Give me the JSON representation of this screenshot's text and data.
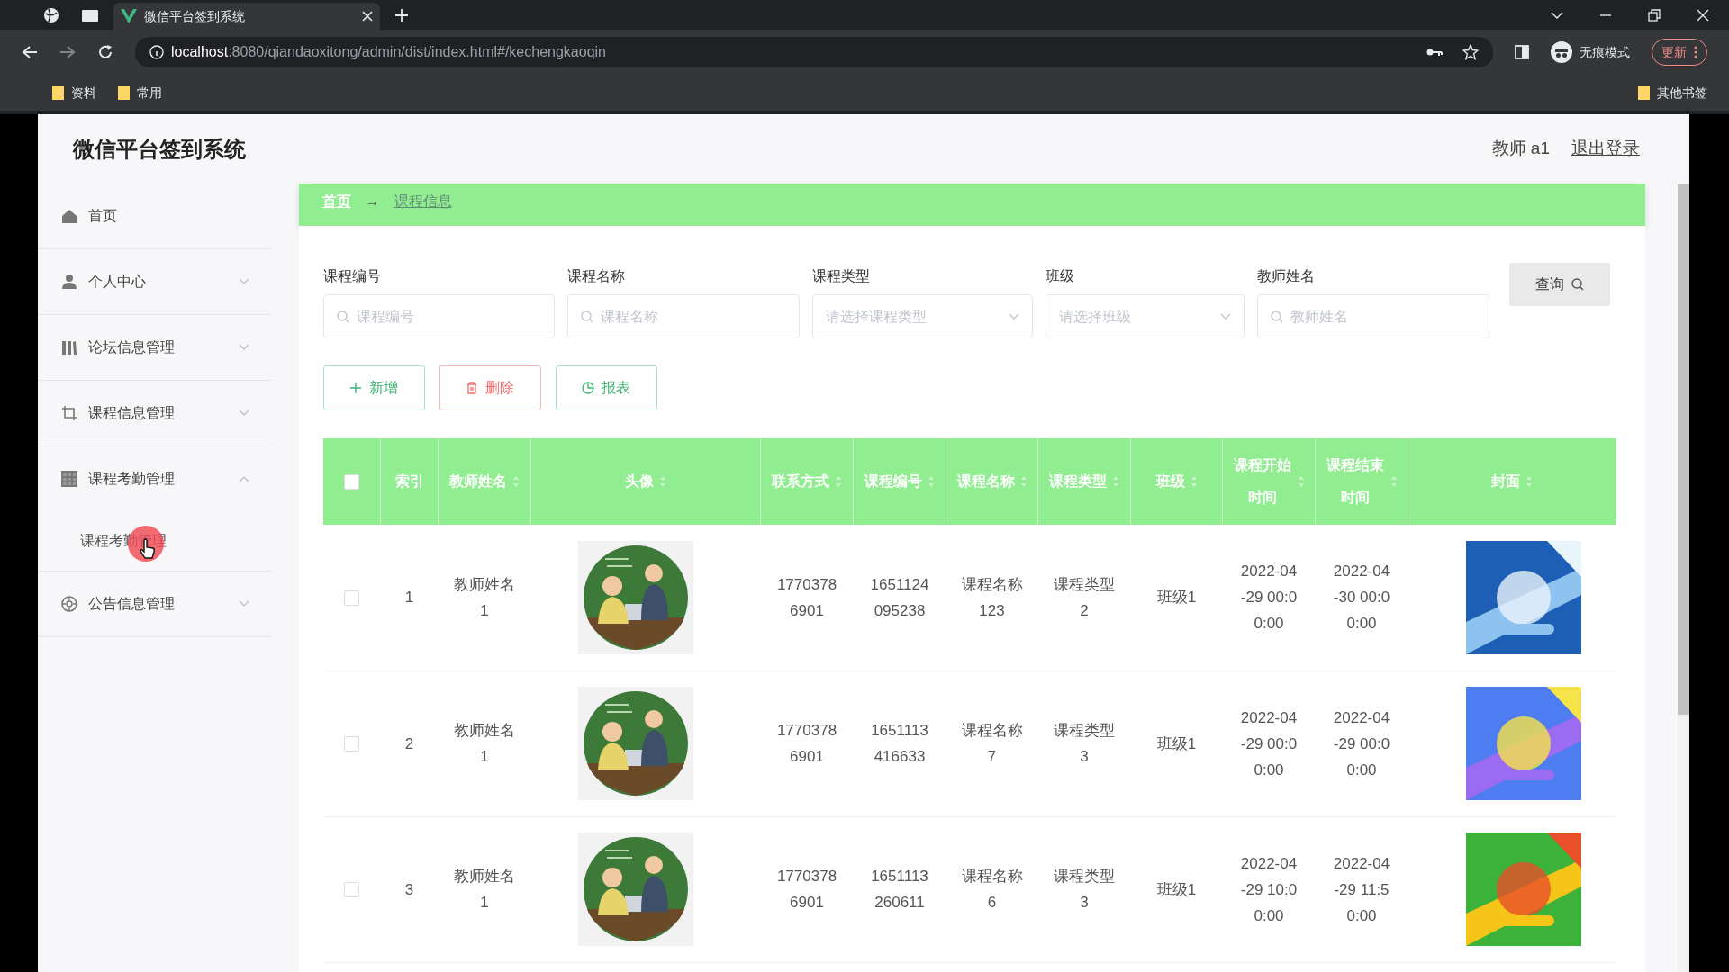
{
  "browser": {
    "tab_title": "微信平台签到系统",
    "url_host": "localhost",
    "url_rest": ":8080/qiandaoxitong/admin/dist/index.html#/kechengkaoqin",
    "incognito_label": "无痕模式",
    "update_label": "更新",
    "bookmarks": [
      "资料",
      "常用"
    ],
    "other_bookmarks": "其他书签"
  },
  "app": {
    "title": "微信平台签到系统",
    "user": "教师 a1",
    "logout": "退出登录"
  },
  "sidebar": {
    "items": [
      {
        "label": "首页",
        "kind": "link"
      },
      {
        "label": "个人中心",
        "kind": "menu",
        "expanded": false
      },
      {
        "label": "论坛信息管理",
        "kind": "menu",
        "expanded": false
      },
      {
        "label": "课程信息管理",
        "kind": "menu",
        "expanded": false
      },
      {
        "label": "课程考勤管理",
        "kind": "menu",
        "expanded": true,
        "children": [
          {
            "label": "课程考勤管理"
          }
        ]
      },
      {
        "label": "公告信息管理",
        "kind": "menu",
        "expanded": false
      }
    ]
  },
  "breadcrumb": {
    "items": [
      "首页",
      "课程信息"
    ],
    "separator": "→"
  },
  "search": {
    "fields": [
      {
        "label": "课程编号",
        "placeholder": "课程编号",
        "kind": "text"
      },
      {
        "label": "课程名称",
        "placeholder": "课程名称",
        "kind": "text"
      },
      {
        "label": "课程类型",
        "placeholder": "请选择课程类型",
        "kind": "select"
      },
      {
        "label": "班级",
        "placeholder": "请选择班级",
        "kind": "select"
      },
      {
        "label": "教师姓名",
        "placeholder": "教师姓名",
        "kind": "text"
      }
    ],
    "button": "查询"
  },
  "actions": [
    {
      "label": "新增",
      "kind": "add"
    },
    {
      "label": "删除",
      "kind": "delete"
    },
    {
      "label": "报表",
      "kind": "report"
    }
  ],
  "table": {
    "select_all": {
      "checked": false
    },
    "columns": [
      {
        "label": "索引",
        "sortable": false
      },
      {
        "label": "教师姓名",
        "sortable": true
      },
      {
        "label": "头像",
        "sortable": true
      },
      {
        "label": "联系方式",
        "sortable": true
      },
      {
        "label": "课程编号",
        "sortable": true
      },
      {
        "label": "课程名称",
        "sortable": true
      },
      {
        "label": "课程类型",
        "sortable": true
      },
      {
        "label": "班级",
        "sortable": true
      },
      {
        "label": "课程开始时间",
        "sortable": true
      },
      {
        "label": "课程结束时间",
        "sortable": true
      },
      {
        "label": "封面",
        "sortable": true
      }
    ],
    "rows": [
      {
        "selected": false,
        "index": "1",
        "teacher": "教师姓名1",
        "phone": "17703786901",
        "course_no": "1651124095238",
        "course_name": "课程名称123",
        "course_type": "课程类型2",
        "class": "班级1",
        "start": "2022-04-29 00:00:00",
        "end": "2022-04-30 00:00:00"
      },
      {
        "selected": false,
        "index": "2",
        "teacher": "教师姓名1",
        "phone": "17703786901",
        "course_no": "1651113416633",
        "course_name": "课程名称7",
        "course_type": "课程类型3",
        "class": "班级1",
        "start": "2022-04-29 00:00:00",
        "end": "2022-04-29 00:00:00"
      },
      {
        "selected": false,
        "index": "3",
        "teacher": "教师姓名1",
        "phone": "17703786901",
        "course_no": "1651113260611",
        "course_name": "课程名称6",
        "course_type": "课程类型3",
        "class": "班级1",
        "start": "2022-04-29 10:00:00",
        "end": "2022-04-29 11:50:00"
      }
    ]
  }
}
